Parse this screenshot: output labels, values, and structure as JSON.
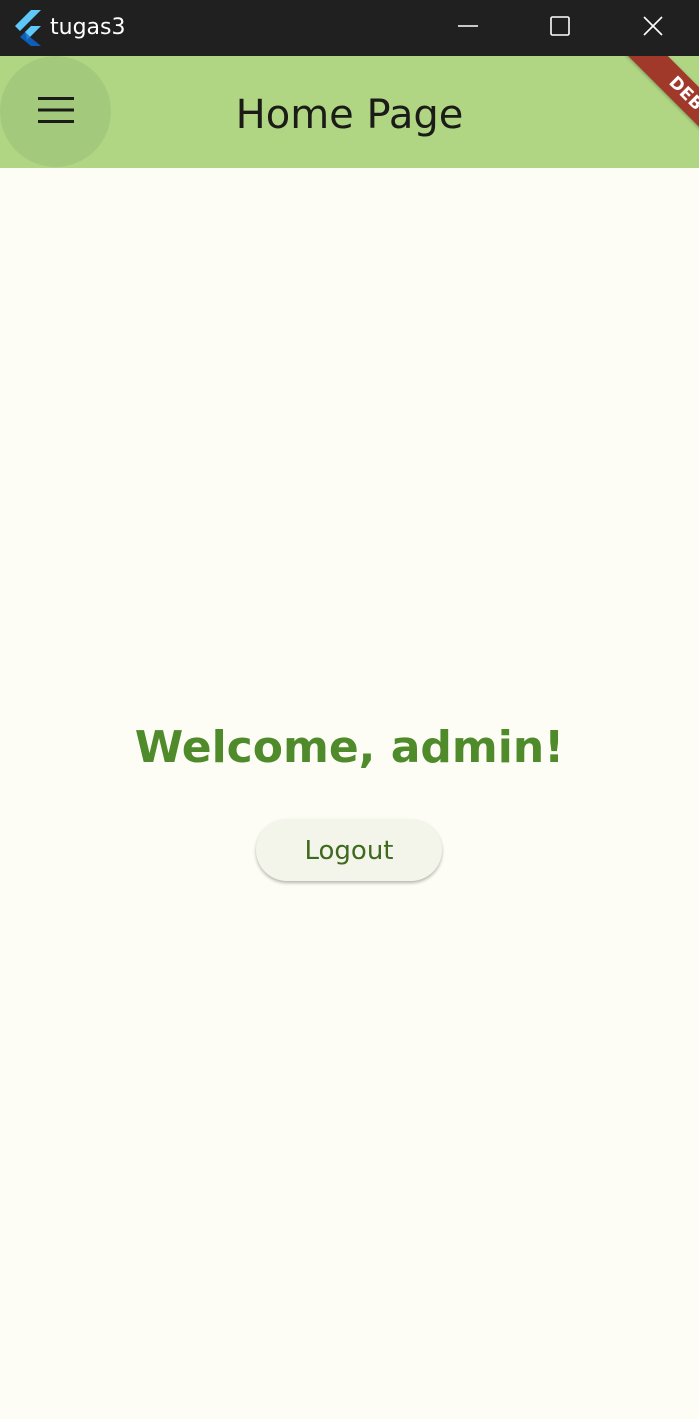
{
  "window": {
    "title": "tugas3",
    "controls": {
      "minimize_icon": "minimize-icon",
      "maximize_icon": "maximize-icon",
      "close_icon": "close-icon"
    }
  },
  "appbar": {
    "title": "Home Page",
    "menu_icon": "hamburger-menu-icon",
    "debug_banner": "DEBUG"
  },
  "main": {
    "welcome_text": "Welcome, admin!",
    "logout_label": "Logout"
  },
  "colors": {
    "titlebar_bg": "#202020",
    "appbar_bg": "#b0d684",
    "page_bg": "#fdfdf5",
    "welcome_text": "#4f8a2b",
    "button_text": "#3f6a1e",
    "debug_banner": "#a1392b"
  }
}
